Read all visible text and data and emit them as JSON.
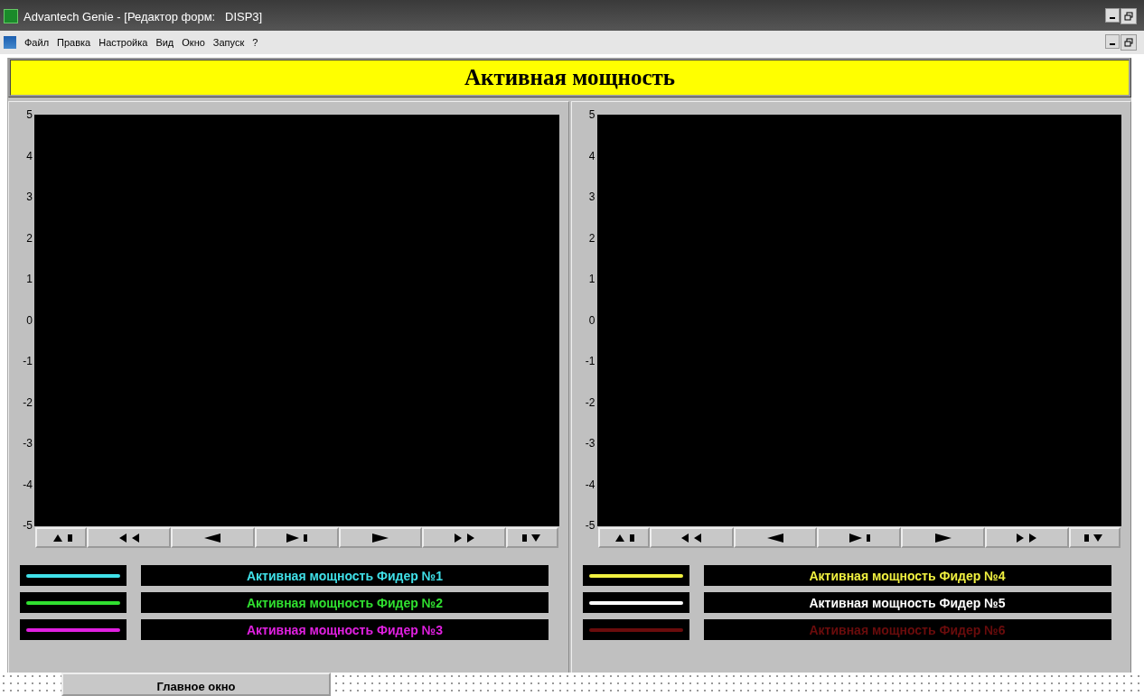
{
  "window": {
    "title": "Advantech Genie - [Редактор форм:   DISP3]"
  },
  "menu": [
    "Файл",
    "Правка",
    "Настройка",
    "Вид",
    "Окно",
    "Запуск",
    "?"
  ],
  "banner": {
    "title": "Активная мощность"
  },
  "panels": [
    {
      "y_ticks": [
        "5",
        "4",
        "3",
        "2",
        "1",
        "0",
        "-1",
        "-2",
        "-3",
        "-4",
        "-5"
      ],
      "nav_buttons": [
        {
          "kind": "scroll-up"
        },
        {
          "kind": "fast-back"
        },
        {
          "kind": "back"
        },
        {
          "kind": "forward-end"
        },
        {
          "kind": "forward"
        },
        {
          "kind": "fast-forward"
        },
        {
          "kind": "scroll-down"
        }
      ],
      "legend": [
        {
          "label": "Активная мощность Фидер №1",
          "color": "#40e0e8"
        },
        {
          "label": "Активная мощность Фидер №2",
          "color": "#30e030"
        },
        {
          "label": "Активная мощность Фидер №3",
          "color": "#e020e0"
        }
      ]
    },
    {
      "y_ticks": [
        "5",
        "4",
        "3",
        "2",
        "1",
        "0",
        "-1",
        "-2",
        "-3",
        "-4",
        "-5"
      ],
      "nav_buttons": [
        {
          "kind": "scroll-up"
        },
        {
          "kind": "fast-back"
        },
        {
          "kind": "back"
        },
        {
          "kind": "forward-end"
        },
        {
          "kind": "forward"
        },
        {
          "kind": "fast-forward"
        },
        {
          "kind": "scroll-down"
        }
      ],
      "legend": [
        {
          "label": "Активная мощность Фидер №4",
          "color": "#f0f040"
        },
        {
          "label": "Активная мощность Фидер №5",
          "color": "#ffffff"
        },
        {
          "label": "Активная мощность Фидер №6",
          "color": "#6a0c0c"
        }
      ]
    }
  ],
  "bottom_tabs": [
    {
      "label": "Главное окно"
    }
  ]
}
